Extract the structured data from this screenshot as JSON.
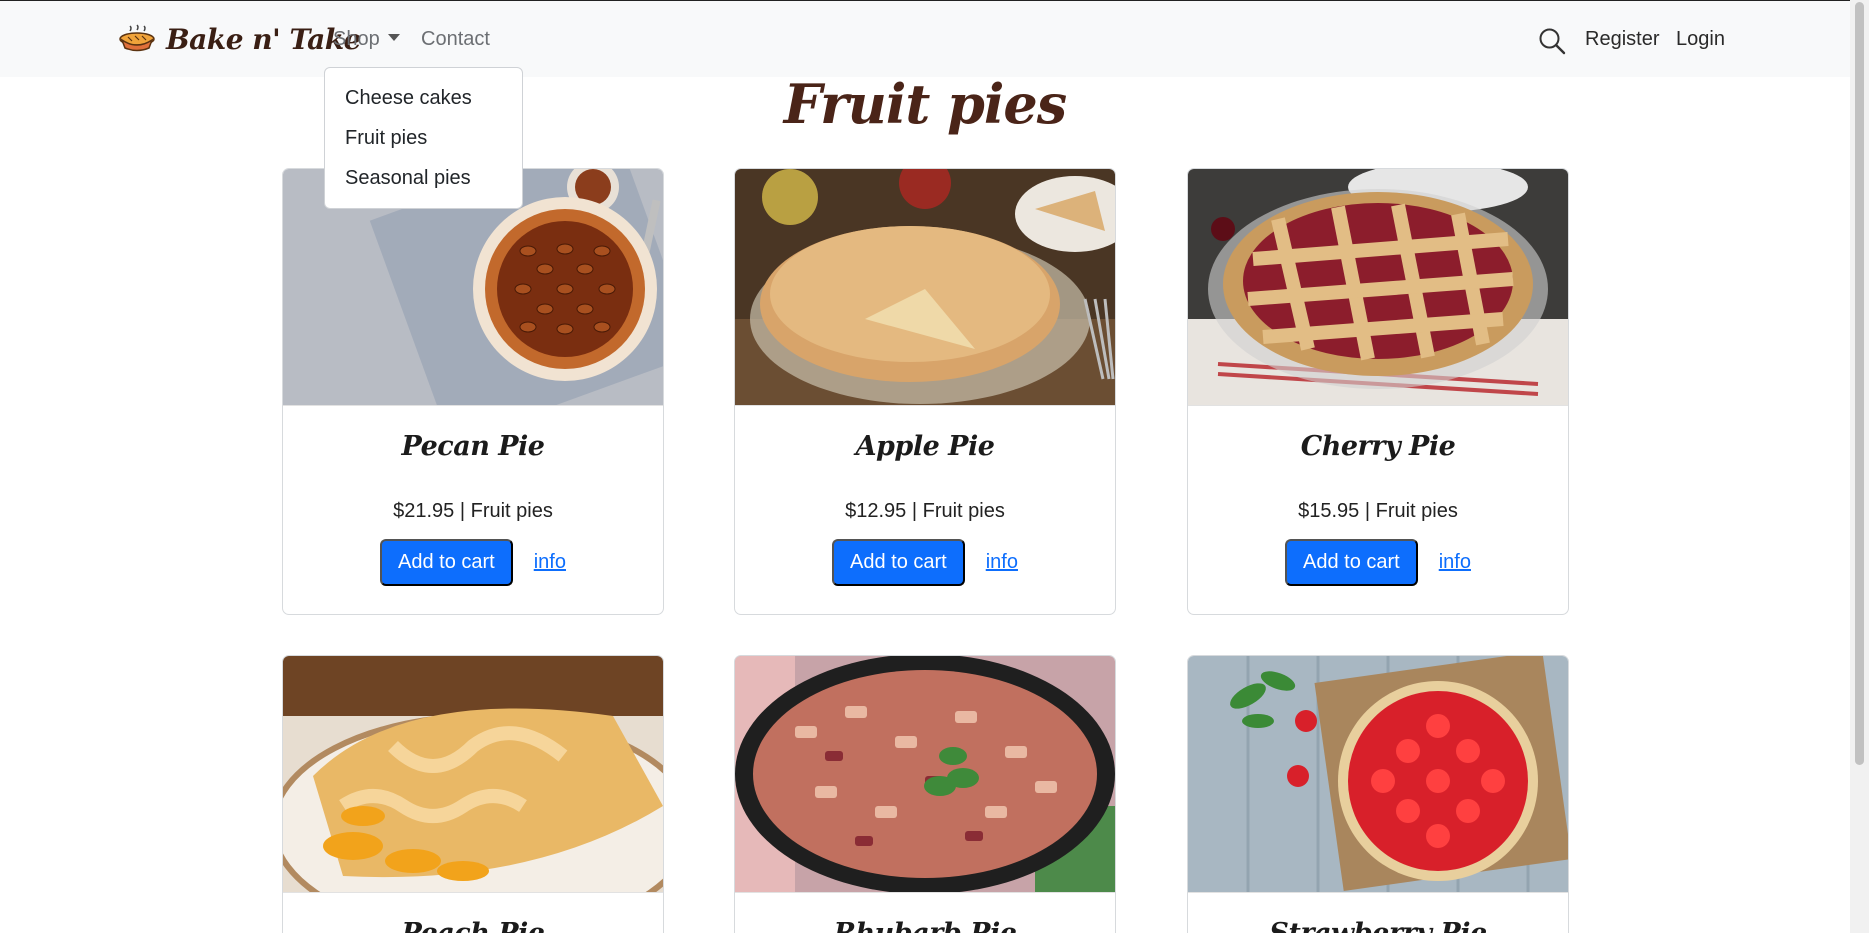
{
  "navbar": {
    "brand": "Bake n' Take",
    "shop_label": "Shop",
    "contact_label": "Contact",
    "register_label": "Register",
    "login_label": "Login",
    "icons": {
      "logo": "pie-logo-icon",
      "search": "search-icon",
      "caret": "caret-down-icon"
    }
  },
  "dropdown": {
    "items": [
      {
        "label": "Cheese cakes"
      },
      {
        "label": "Fruit pies"
      },
      {
        "label": "Seasonal pies"
      }
    ]
  },
  "page": {
    "title": "Fruit pies"
  },
  "products": [
    {
      "name": "Pecan Pie",
      "price": "$21.95",
      "category": "Fruit pies",
      "meta": "$21.95 | Fruit pies",
      "add_label": "Add to cart",
      "info_label": "info"
    },
    {
      "name": "Apple Pie",
      "price": "$12.95",
      "category": "Fruit pies",
      "meta": "$12.95 | Fruit pies",
      "add_label": "Add to cart",
      "info_label": "info"
    },
    {
      "name": "Cherry Pie",
      "price": "$15.95",
      "category": "Fruit pies",
      "meta": "$15.95 | Fruit pies",
      "add_label": "Add to cart",
      "info_label": "info"
    },
    {
      "name": "Peach Pie"
    },
    {
      "name": "Rhubarb Pie"
    },
    {
      "name": "Strawberry Pie"
    }
  ],
  "colors": {
    "primary": "#0d6efd",
    "brand": "#3a1f14",
    "title": "#4a2418",
    "navbar_bg": "#f8f9fa"
  }
}
